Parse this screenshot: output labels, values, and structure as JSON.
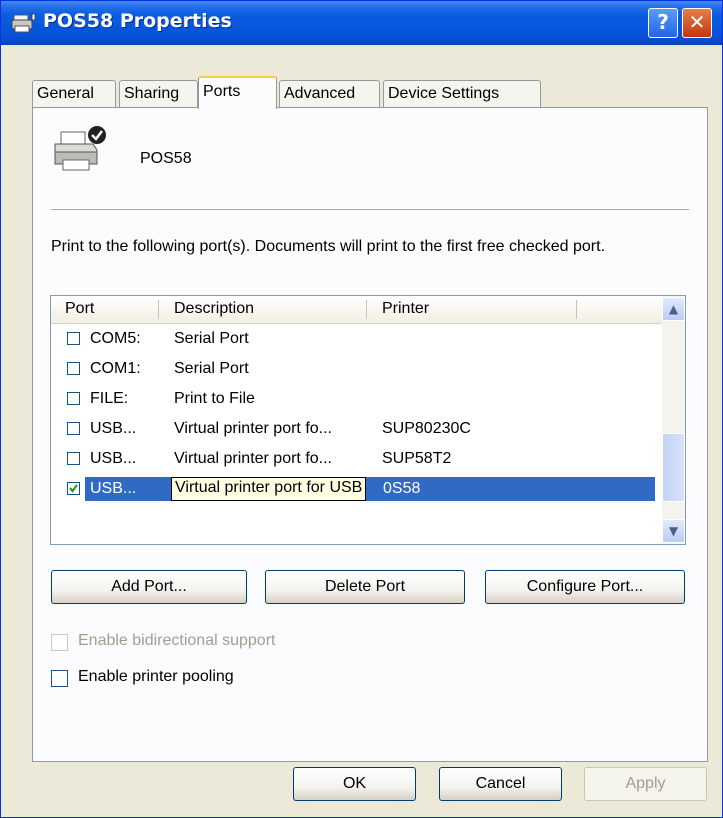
{
  "window": {
    "title": "POS58 Properties"
  },
  "title_buttons": {
    "help": "?",
    "close": "✕"
  },
  "tabs": [
    {
      "label": "General"
    },
    {
      "label": "Sharing"
    },
    {
      "label": "Ports"
    },
    {
      "label": "Advanced"
    },
    {
      "label": "Device Settings"
    }
  ],
  "printer": {
    "name": "POS58"
  },
  "instructions": "Print to the following port(s). Documents will print to the first free checked port.",
  "ports_list": {
    "columns": [
      "Port",
      "Description",
      "Printer"
    ],
    "rows": [
      {
        "port": "COM5:",
        "description": "Serial Port",
        "printer": "",
        "checked": false
      },
      {
        "port": "COM1:",
        "description": "Serial Port",
        "printer": "",
        "checked": false
      },
      {
        "port": "FILE:",
        "description": "Print to File",
        "printer": "",
        "checked": false
      },
      {
        "port": "USB...",
        "description": "Virtual printer port fo...",
        "printer": "SUP80230C",
        "checked": false
      },
      {
        "port": "USB...",
        "description": "Virtual printer port fo...",
        "printer": "SUP58T2",
        "checked": false
      },
      {
        "port": "USB...",
        "description": "",
        "printer": "0S58",
        "checked": true,
        "selected": true
      }
    ],
    "tooltip": "Virtual printer port for USB"
  },
  "port_buttons": {
    "add": "Add Port...",
    "delete": "Delete Port",
    "configure": "Configure Port..."
  },
  "options": {
    "bidirectional": {
      "label": "Enable bidirectional support",
      "checked": false,
      "enabled": false
    },
    "pooling": {
      "label": "Enable printer pooling",
      "checked": false,
      "enabled": true
    }
  },
  "dialog_buttons": {
    "ok": "OK",
    "cancel": "Cancel",
    "apply": "Apply"
  }
}
